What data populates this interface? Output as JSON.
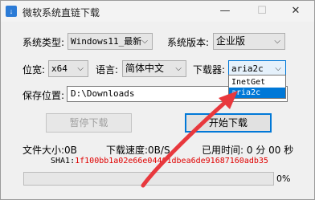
{
  "window": {
    "title": "微软系统直链下载",
    "icon": "app-icon",
    "controls": [
      "minimize-icon",
      "maximize-icon",
      "close-icon"
    ]
  },
  "form": {
    "system_type_label": "系统类型:",
    "system_type_value": "Windows11_最新",
    "system_version_label": "系统版本:",
    "system_version_value": "企业版",
    "arch_label": "位宽:",
    "arch_value": "x64",
    "language_label": "语言:",
    "language_value": "简体中文",
    "downloader_label": "下载器:",
    "downloader_value": "aria2c",
    "downloader_options": [
      "InetGet",
      "aria2c"
    ],
    "downloader_selected": "aria2c",
    "save_path_label": "保存位置:",
    "save_path_value": "D:\\Downloads"
  },
  "buttons": {
    "pause_label": "暂停下载",
    "start_label": "开始下载"
  },
  "status": {
    "file_size": "文件大小:0B",
    "speed": "下载速度:0B/S",
    "elapsed": "已用时间: 0 分 00 秒",
    "sha1_label": "SHA1:",
    "sha1_value": "1f100bb1a02e66e04401dbea6de91687160adb35",
    "progress_percent": 0,
    "progress_text": "0%"
  },
  "colors": {
    "accent": "#0078d7",
    "sha_value": "#e00000",
    "annotation_arrow": "#e8383d"
  }
}
